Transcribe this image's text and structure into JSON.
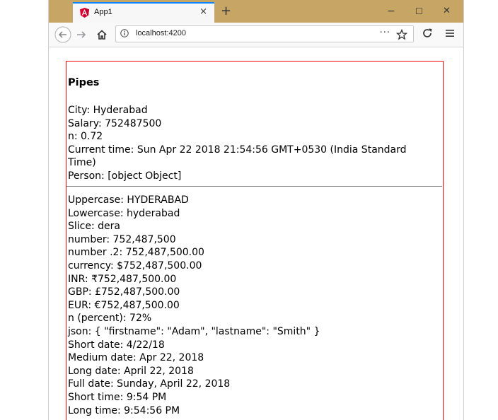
{
  "browser": {
    "tab_title": "App1",
    "tab_close": "×",
    "new_tab": "+",
    "url": "localhost:4200",
    "url_more": "···",
    "controls": {
      "minimize": "−",
      "maximize": "☐",
      "close": "✕"
    }
  },
  "page": {
    "heading": "Pipes",
    "info": [
      "City: Hyderabad",
      "Salary: 752487500",
      "n: 0.72",
      "Current time: Sun Apr 22 2018 21:54:56 GMT+0530 (India Standard Time)",
      "Person: [object Object]"
    ],
    "pipes": [
      "Uppercase: HYDERABAD",
      "Lowercase: hyderabad",
      "Slice: dera",
      "number: 752,487,500",
      "number .2: 752,487,500.00",
      "currency: $752,487,500.00",
      "INR: ₹752,487,500.00",
      "GBP: £752,487,500.00",
      "EUR: €752,487,500.00",
      "n (percent): 72%",
      "json: { \"firstname\": \"Adam\", \"lastname\": \"Smith\" }",
      "Short date: 4/22/18",
      "Medium date: Apr 22, 2018",
      "Long date: April 22, 2018",
      "Full date: Sunday, April 22, 2018",
      "Short time: 9:54 PM",
      "Long time: 9:54:56 PM"
    ]
  },
  "colors": {
    "titlebar": "#c7a564",
    "tab_accent": "#0a84ff",
    "border_red": "#ff0000",
    "angular_red": "#dd0031"
  }
}
